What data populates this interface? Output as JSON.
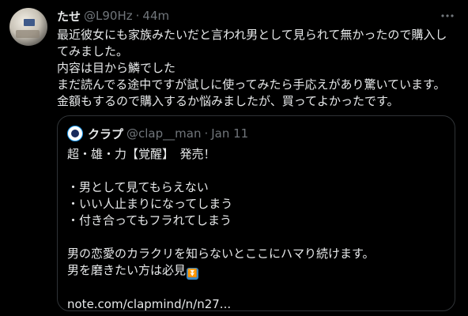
{
  "tweet": {
    "author_name": "たせ",
    "author_handle": "@L90Hz",
    "separator": "·",
    "time": "44m",
    "text_lines": [
      "最近彼女にも家族みたいだと言われ男として見られて無かったので購入し",
      "てみました。",
      "内容は目から鱗でした",
      "まだ読んでる途中ですが試しに使ってみたら手応えがあり驚いています。",
      "金額もするので購入するか悩みましたが、買ってよかったです。"
    ]
  },
  "quote": {
    "author_name": "クラプ",
    "author_handle": "@clap__man",
    "separator": "·",
    "date": "Jan 11",
    "lines": [
      "超・雄・力【覚醒】　発売！",
      "",
      "・男として見てもらえない",
      "・いい人止まりになってしまう",
      "・付き合ってもフラれてしまう",
      "",
      "男の恋愛のカラクリを知らないとここにハマり続けます。",
      "男を磨きたい方は必見",
      "",
      "note.com/clapmind/n/n27..."
    ],
    "emoji": "⏬"
  },
  "icons": {
    "more": "more-horizontal-icon",
    "avatar": "user-avatar",
    "quote_avatar": "quote-user-avatar"
  },
  "colors": {
    "background": "#000000",
    "text": "#e7e9ea",
    "secondary": "#71767b",
    "border": "#2f3336",
    "emoji_bg": "#3b88c3"
  }
}
